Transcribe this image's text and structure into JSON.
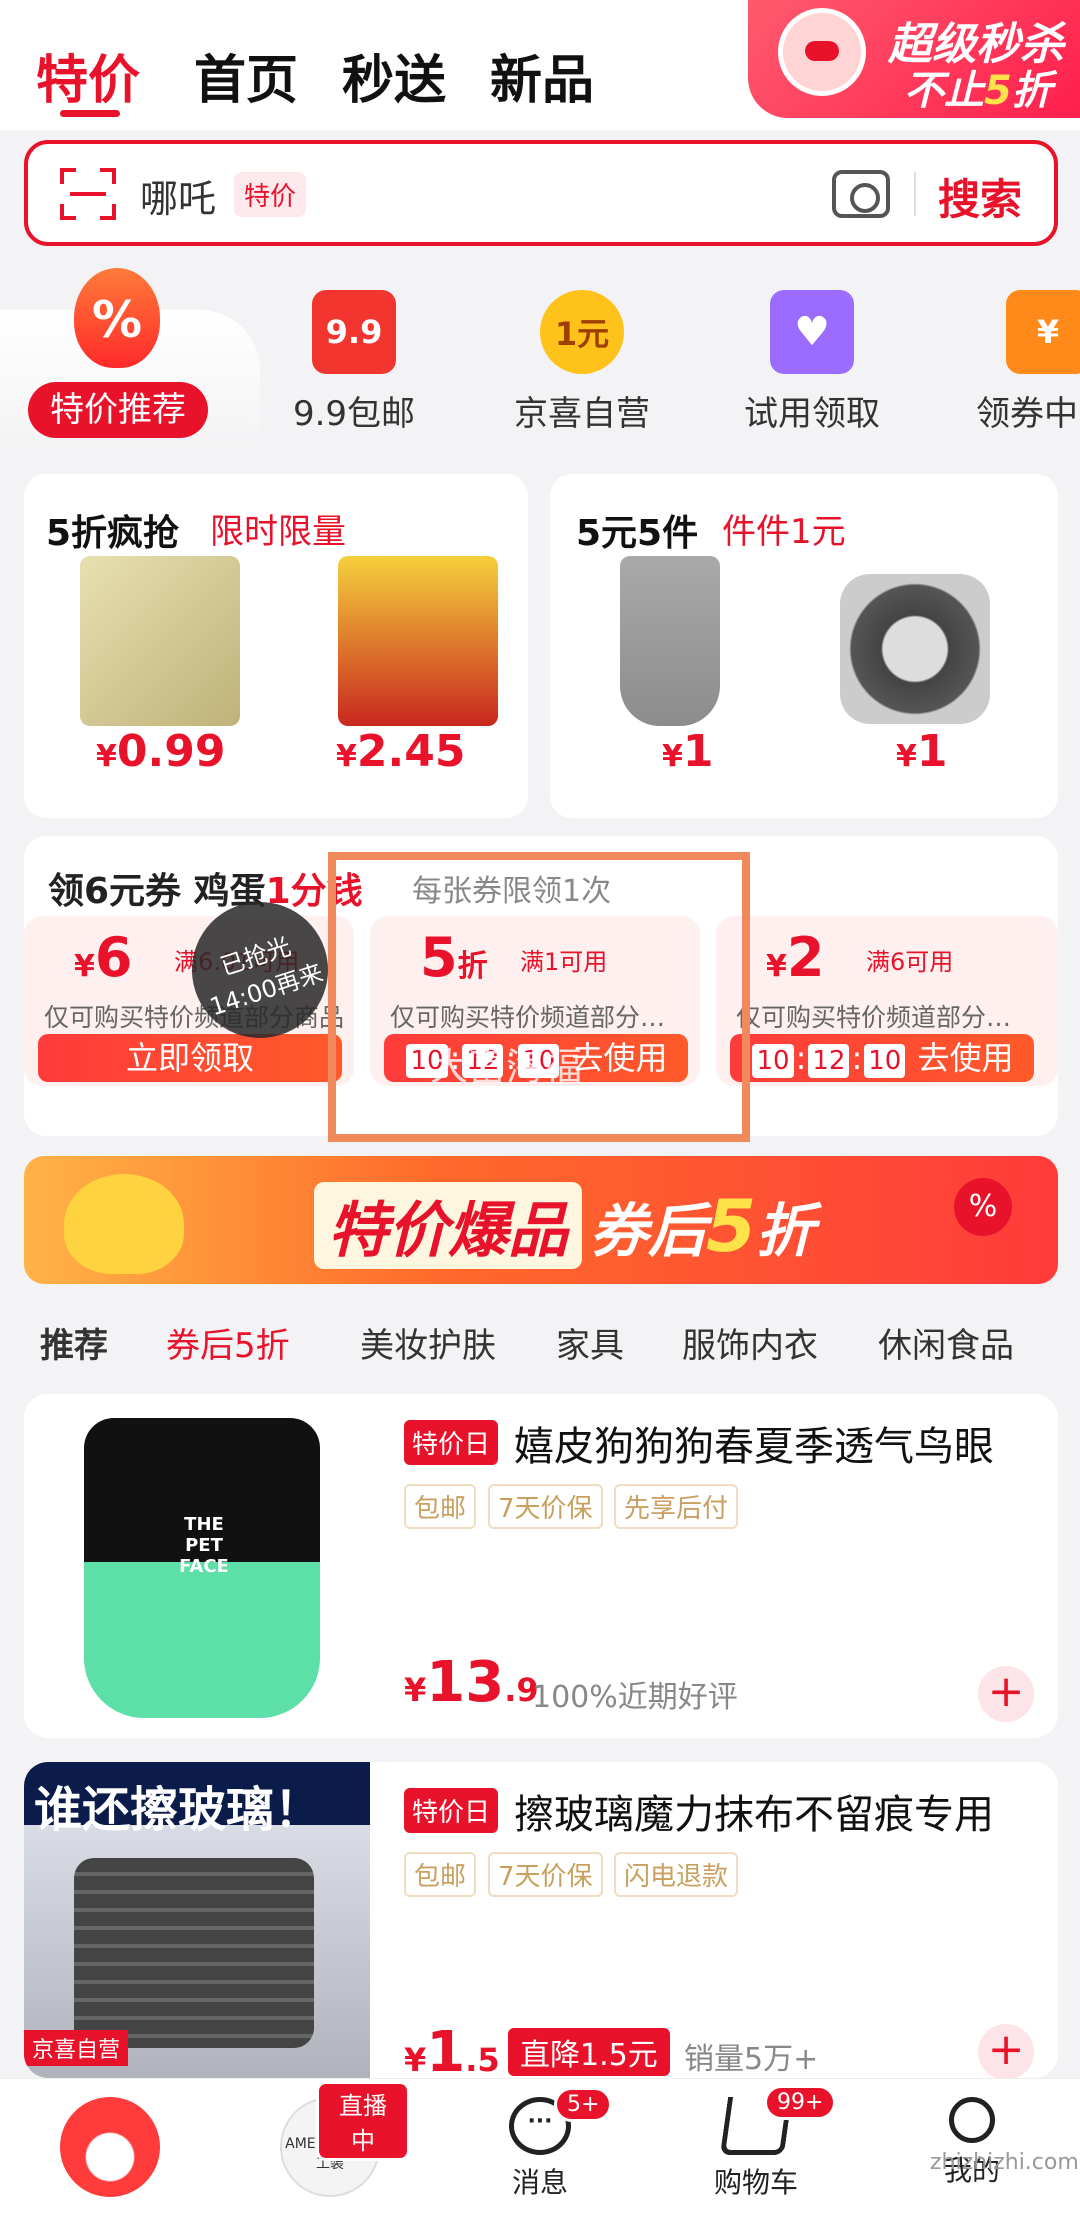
{
  "top_nav": {
    "tabs": [
      "特价",
      "首页",
      "秒送",
      "新品"
    ],
    "flash_sale": {
      "line1": "超级秒杀",
      "line2_prefix": "不止",
      "line2_num": "5",
      "line2_suffix": "折"
    }
  },
  "search": {
    "query": "哪吒",
    "tag": "特价",
    "button": "搜索"
  },
  "channels": [
    {
      "label": "特价推荐",
      "icon": "fire-percent-icon",
      "icon_text": "%"
    },
    {
      "label": "9.9包邮",
      "icon": "gift-bag-icon",
      "icon_text": "9.9",
      "color": "#f2362f"
    },
    {
      "label": "京喜自营",
      "icon": "star-badge-icon",
      "icon_text": "1元",
      "color": "#ffc21a"
    },
    {
      "label": "试用领取",
      "icon": "shopping-bag-heart-icon",
      "icon_text": "♥",
      "color": "#9b6cff"
    },
    {
      "label": "领券中",
      "icon": "coupon-icon",
      "icon_text": "¥",
      "color": "#ff8a1a"
    }
  ],
  "promo_cards": [
    {
      "title": "5折疯抢",
      "subtitle": "限时限量",
      "items": [
        {
          "price": "0.99",
          "img": "tea-pack"
        },
        {
          "price": "2.45",
          "img": "dates-pack"
        }
      ]
    },
    {
      "title": "5元5件",
      "subtitle": "件件1元",
      "items": [
        {
          "price": "1",
          "img": "comb"
        },
        {
          "price": "1",
          "img": "lint-balls"
        }
      ]
    }
  ],
  "coupon_section": {
    "title_a": "领6元券 鸡蛋",
    "title_b": "1分钱",
    "note": "每张券限领1次",
    "sold_out_line1": "已抢光",
    "sold_out_line2": "14:00再来",
    "watermark": "大富海福",
    "coupons": [
      {
        "value": "6",
        "unit": "",
        "condition": "满6.01可用",
        "desc": "仅可购买特价频道部分商品",
        "button": "立即领取"
      },
      {
        "value": "5",
        "unit": "折",
        "condition": "满1可用",
        "desc": "仅可购买特价频道部分…",
        "timer": [
          "10",
          "12",
          "10"
        ],
        "button": "去使用"
      },
      {
        "value": "2",
        "unit": "",
        "condition": "满6可用",
        "desc": "仅可购买特价频道部分…",
        "timer": [
          "10",
          "12",
          "10"
        ],
        "button": "去使用"
      }
    ]
  },
  "hot_banner": {
    "title": "特价爆品",
    "sub_prefix": "券后",
    "sub_num": "5",
    "sub_suffix": "折",
    "badge": "%"
  },
  "categories": [
    "推荐",
    "券后5折",
    "美妆护肤",
    "家具",
    "服饰内衣",
    "休闲食品"
  ],
  "products": [
    {
      "badge": "特价日",
      "title": "嬉皮狗狗狗春夏季透气鸟眼",
      "tags": [
        "包邮",
        "7天价保",
        "先享后付"
      ],
      "price_int": "13",
      "price_dec": ".9",
      "meta": "100%近期好评",
      "img_text": "THE PET FACE"
    },
    {
      "badge": "特价日",
      "title": "擦玻璃魔力抹布不留痕专用",
      "tags": [
        "包邮",
        "7天价保",
        "闪电退款"
      ],
      "price_int": "1",
      "price_dec": ".5",
      "drop": "直降1.5元",
      "meta": "销量5万+",
      "img_text": "谁还擦玻璃！",
      "img_badge": "京喜自营"
    }
  ],
  "bottom_nav": {
    "live_badge": "直播中",
    "live_brand": "AMEKAJI 马鑫工装",
    "messages": {
      "label": "消息",
      "badge": "5+"
    },
    "cart": {
      "label": "购物车",
      "badge": "99+"
    },
    "me": {
      "label": "我的"
    }
  },
  "site_watermark": "zhizhizhi.com",
  "colors": {
    "brand": "#e8132b",
    "accent": "#ff6a2a",
    "bg": "#f3f3f5"
  }
}
